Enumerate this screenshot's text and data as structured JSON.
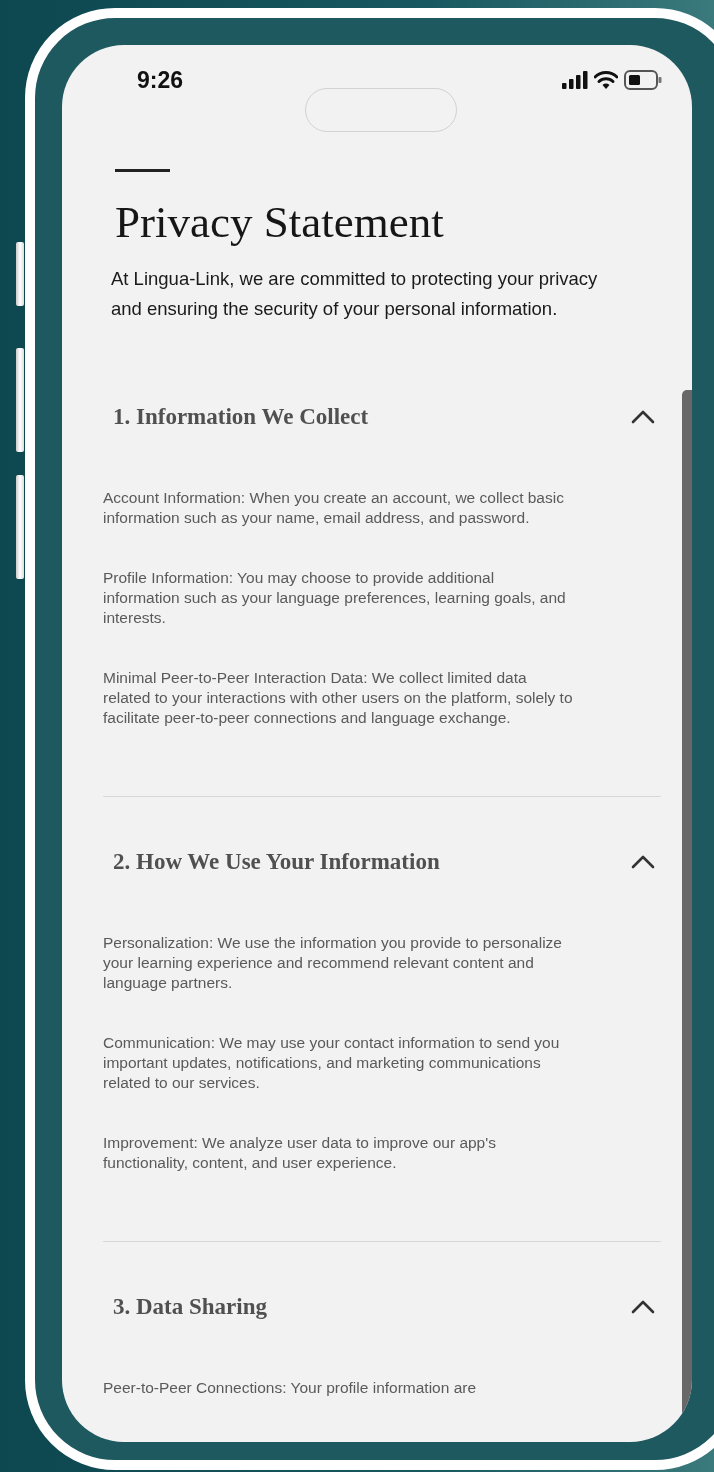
{
  "status_bar": {
    "time": "9:26"
  },
  "title": "Privacy Statement",
  "intro": "At Lingua-Link, we are committed to protecting your privacy and ensuring the security of your personal information.",
  "sections": [
    {
      "title": "1. Information We Collect",
      "expanded": true,
      "paragraphs": [
        "Account Information: When you create an account, we collect basic information such as your name, email address, and password.",
        "Profile Information: You may choose to provide additional information such as your language preferences, learning goals, and interests.",
        "Minimal Peer-to-Peer Interaction Data: We collect limited data related to your interactions with other users on the platform, solely to facilitate peer-to-peer connections and language exchange."
      ]
    },
    {
      "title": "2. How We Use Your Information",
      "expanded": true,
      "paragraphs": [
        "Personalization: We use the information you provide to personalize your learning experience and recommend relevant content and language partners.",
        "Communication: We may use your contact information to send you important updates, notifications, and marketing communications related to our services.",
        "Improvement: We analyze user data to improve our app's functionality, content, and user experience."
      ]
    },
    {
      "title": "3. Data Sharing",
      "expanded": true,
      "paragraphs": [
        "Peer-to-Peer Connections: Your profile information  are"
      ]
    }
  ]
}
